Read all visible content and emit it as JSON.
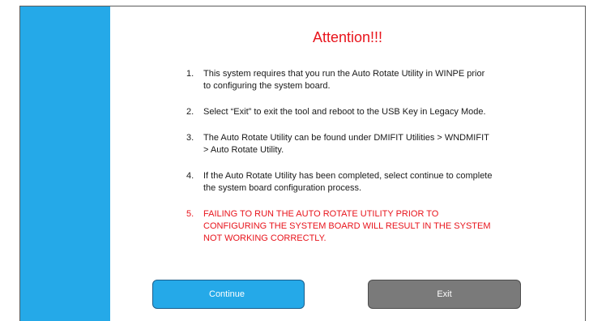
{
  "dialog": {
    "title": "Attention!!!",
    "items": [
      {
        "num": "1.",
        "text": "This system requires that you run the Auto Rotate Utility in WINPE prior to configuring the system board."
      },
      {
        "num": "2.",
        "text": "Select “Exit” to exit the tool and reboot to the USB Key in Legacy Mode."
      },
      {
        "num": "3.",
        "text": "The Auto Rotate Utility can be found under DMIFIT Utilities > WNDMIFIT > Auto Rotate Utility."
      },
      {
        "num": "4.",
        "text": "If the Auto Rotate Utility has been completed, select continue to complete the system board configuration process."
      },
      {
        "num": "5.",
        "text": "FAILING TO RUN THE AUTO ROTATE UTILITY PRIOR TO CONFIGURING THE SYSTEM BOARD WILL RESULT IN THE SYSTEM NOT WORKING CORRECTLY."
      }
    ],
    "continue_label": "Continue",
    "exit_label": "Exit"
  },
  "colors": {
    "sidebar": "#25a9e8",
    "title": "#e8141c",
    "warning": "#e8141c",
    "continue_button": "#25a9e8",
    "exit_button": "#7a7a7a"
  }
}
